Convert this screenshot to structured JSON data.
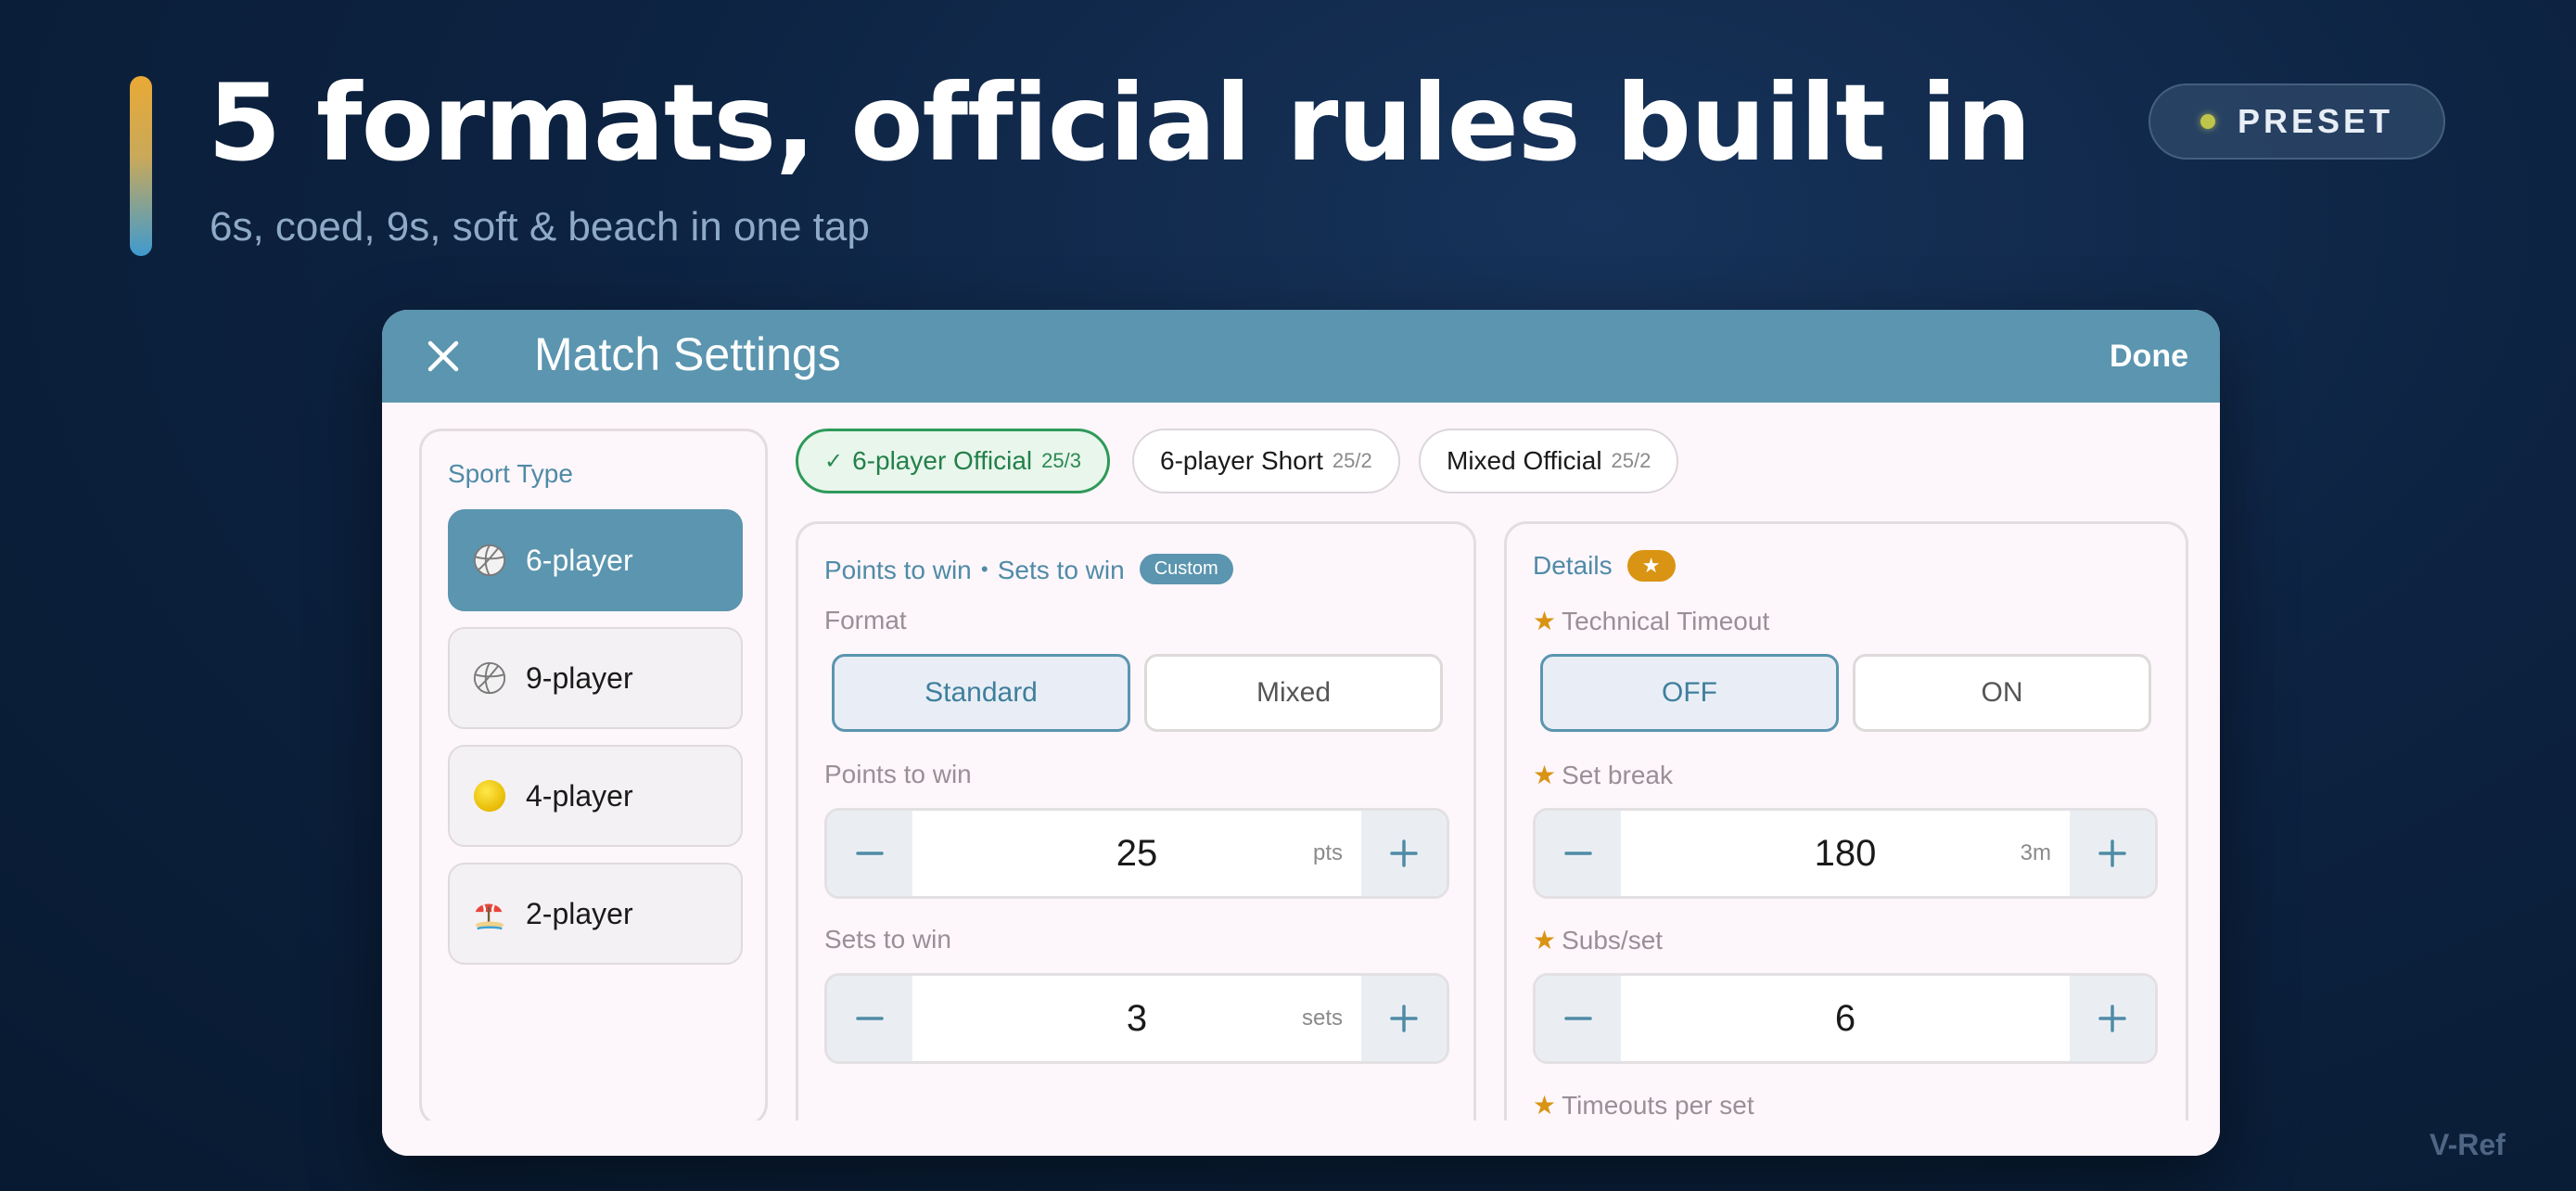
{
  "header": {
    "headline": "5 formats, official rules built in",
    "subline": "6s, coed, 9s, soft & beach in one tap",
    "badge": "PRESET",
    "watermark": "V-Ref"
  },
  "modal": {
    "title": "Match Settings",
    "done_label": "Done",
    "close_icon": "close-icon"
  },
  "sidebar": {
    "label": "Sport Type",
    "items": [
      {
        "label": "6-player",
        "icon": "volleyball-icon",
        "selected": true
      },
      {
        "label": "9-player",
        "icon": "volleyball-icon",
        "selected": false
      },
      {
        "label": "4-player",
        "icon": "yellow-ball-icon",
        "selected": false
      },
      {
        "label": "2-player",
        "icon": "beach-umbrella-icon",
        "selected": false
      }
    ]
  },
  "presets": [
    {
      "check": "✓",
      "name": "6-player Official",
      "ratio": "25/3",
      "selected": true
    },
    {
      "check": "",
      "name": "6-player Short",
      "ratio": "25/2",
      "selected": false
    },
    {
      "check": "",
      "name": "Mixed Official",
      "ratio": "25/2",
      "selected": false
    }
  ],
  "rules_panel": {
    "title": "Points to win・Sets to win",
    "badge": "Custom",
    "format_label": "Format",
    "format_options": [
      "Standard",
      "Mixed"
    ],
    "format_selected": "Standard",
    "points": {
      "label": "Points to win",
      "value": "25",
      "unit": "pts"
    },
    "sets": {
      "label": "Sets to win",
      "value": "3",
      "unit": "sets"
    }
  },
  "details_panel": {
    "title": "Details",
    "badge": "★",
    "star": "★",
    "tto_label": "Technical Timeout",
    "tto_options": [
      "OFF",
      "ON"
    ],
    "tto_selected": "OFF",
    "set_break": {
      "label": "Set break",
      "value": "180",
      "unit": "3m"
    },
    "subs": {
      "label": "Subs/set",
      "value": "6",
      "unit": ""
    },
    "timeouts_label": "Timeouts per set"
  },
  "colors": {
    "accent": "#5b95af",
    "selected_green": "#2e9a59",
    "star_orange": "#d99413",
    "background": "#0d2342"
  }
}
